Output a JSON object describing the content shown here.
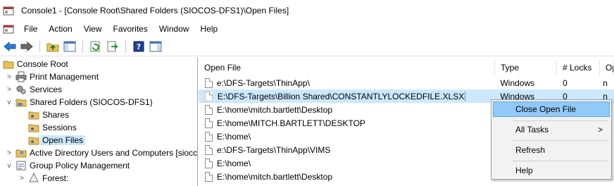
{
  "window": {
    "title": "Console1 - [Console Root\\Shared Folders (SIOCOS-DFS1)\\Open Files]"
  },
  "menu": [
    "File",
    "Action",
    "View",
    "Favorites",
    "Window",
    "Help"
  ],
  "toolbar": {
    "icons": [
      "back-arrow-icon",
      "forward-arrow-icon",
      "up-folder-icon",
      "show-hide-tree-icon",
      "refresh-icon",
      "export-list-icon",
      "help-icon",
      "show-hide-action-pane-icon"
    ]
  },
  "tree": {
    "items": [
      {
        "label": "Console Root",
        "level": 0,
        "chevron": "",
        "icon": "folder-icon"
      },
      {
        "label": "Print Management",
        "level": 1,
        "chevron": ">",
        "icon": "printer-icon"
      },
      {
        "label": "Services",
        "level": 1,
        "chevron": ">",
        "icon": "services-icon"
      },
      {
        "label": "Shared Folders (SIOCOS-DFS1)",
        "level": 1,
        "chevron": "v",
        "icon": "shared-folder-icon"
      },
      {
        "label": "Shares",
        "level": 2,
        "chevron": "",
        "icon": "shares-icon"
      },
      {
        "label": "Sessions",
        "level": 2,
        "chevron": "",
        "icon": "sessions-icon"
      },
      {
        "label": "Open Files",
        "level": 2,
        "chevron": "",
        "icon": "open-files-icon",
        "selected": true
      },
      {
        "label": "Active Directory Users and Computers [siocc",
        "level": 1,
        "chevron": ">",
        "icon": "ad-users-icon"
      },
      {
        "label": "Group Policy Management",
        "level": 1,
        "chevron": "v",
        "icon": "group-policy-icon"
      },
      {
        "label": "Forest:",
        "level": 2,
        "chevron": ">",
        "icon": "forest-icon"
      }
    ]
  },
  "list": {
    "columns": [
      "Open File",
      "Type",
      "# Locks",
      "Open Mode"
    ],
    "rows": [
      {
        "path": "e:\\DFS-Targets\\ThinApp\\",
        "type": "Windows",
        "locks": "0",
        "mode": "n"
      },
      {
        "path": "E:\\DFS-Targets\\Billion Shared\\CONSTANTLYLOCKEDFILE.XLSX",
        "type": "Windows",
        "locks": "0",
        "mode": "n",
        "selected": true
      },
      {
        "path": "E:\\home\\mitch.bartlett\\Desktop",
        "type": "",
        "locks": "",
        "mode": ""
      },
      {
        "path": "E:\\home\\MITCH.BARTLETT\\DESKTOP",
        "type": "",
        "locks": "",
        "mode": ""
      },
      {
        "path": "E:\\home\\",
        "type": "",
        "locks": "",
        "mode": ""
      },
      {
        "path": "e:\\DFS-Targets\\ThinApp\\VIMS",
        "type": "",
        "locks": "",
        "mode": ""
      },
      {
        "path": "E:\\home\\",
        "type": "",
        "locks": "",
        "mode": ""
      },
      {
        "path": "E:\\home\\mitch.bartlett\\Desktop",
        "type": "",
        "locks": "",
        "mode": ""
      }
    ]
  },
  "context_menu": {
    "items": [
      "Close Open File",
      "All Tasks",
      "Refresh",
      "Help"
    ],
    "submenu_arrow": ">"
  }
}
